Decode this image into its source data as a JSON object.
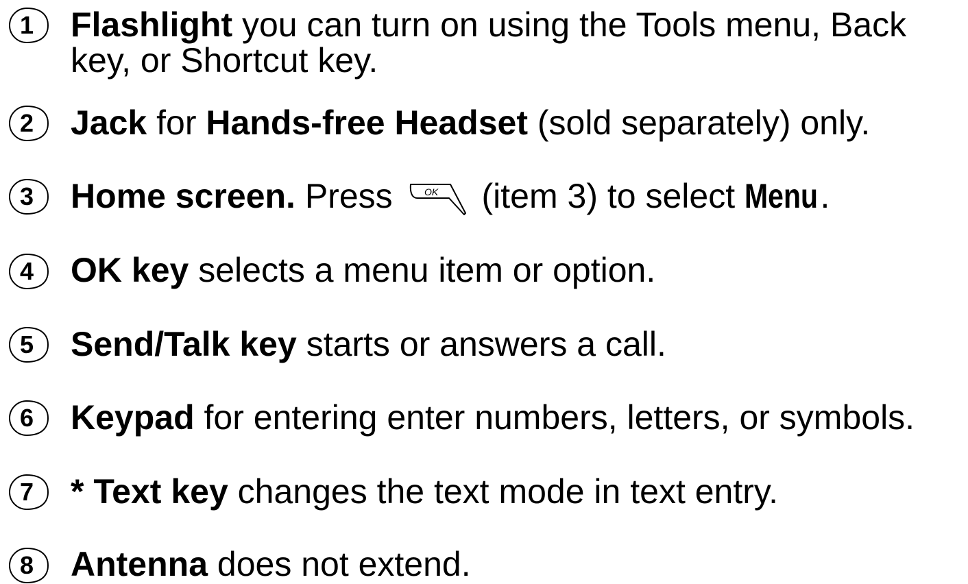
{
  "items": [
    {
      "number": "1",
      "bold": "Flashlight",
      "text": " you can turn on using the Tools menu, Back",
      "text2": "key, or Shortcut key."
    },
    {
      "number": "2",
      "bold": "Jack",
      "text": " for ",
      "bold2": "Hands-free Headset",
      "text2": " (sold separately) only."
    },
    {
      "number": "3",
      "bold": "Home screen.",
      "text": " Press ",
      "icon": "ok-key-icon",
      "text2": "(item 3) to select ",
      "menu_word": "Menu",
      "text3": "."
    },
    {
      "number": "4",
      "bold": "OK key",
      "text": " selects a menu item or option."
    },
    {
      "number": "5",
      "bold": "Send/Talk key",
      "text": " starts or answers a call."
    },
    {
      "number": "6",
      "bold": "Keypad",
      "text": " for entering enter numbers, letters, or symbols."
    },
    {
      "number": "7",
      "bold": "* Text key",
      "text": " changes the text mode in text entry."
    },
    {
      "number": "8",
      "bold": "Antenna",
      "text": " does not extend."
    }
  ]
}
